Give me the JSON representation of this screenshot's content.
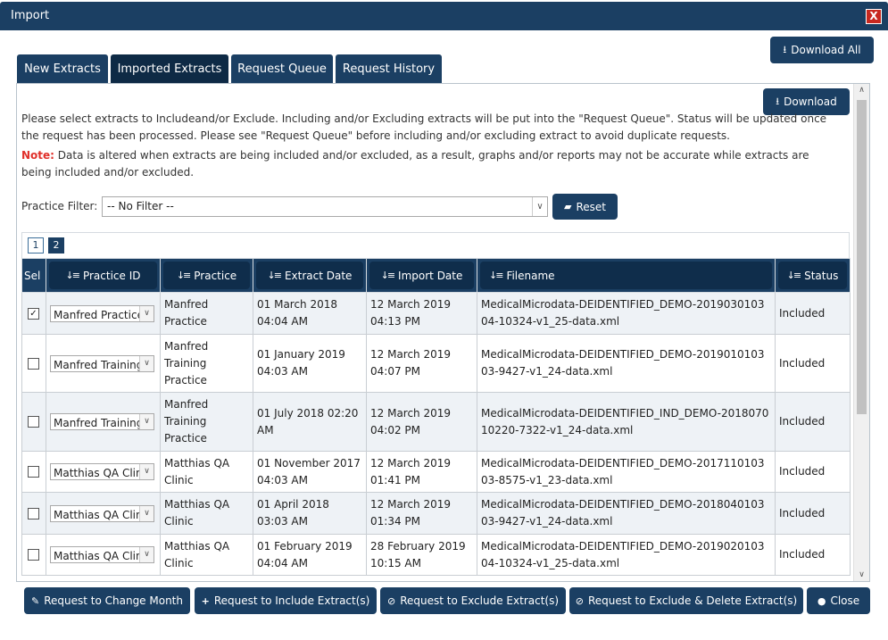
{
  "window": {
    "title": "Import",
    "close_glyph": "X"
  },
  "toolbar": {
    "download_all": "Download All",
    "download": "Download",
    "reset": "Reset"
  },
  "tabs": [
    {
      "label": "New Extracts",
      "active": false
    },
    {
      "label": "Imported Extracts",
      "active": true
    },
    {
      "label": "Request Queue",
      "active": false
    },
    {
      "label": "Request History",
      "active": false
    }
  ],
  "intro": "Please select extracts to Includeand/or Exclude. Including and/or Excluding extracts will be put into the \"Request Queue\". Status will be updated once the request has been processed. Please see \"Request Queue\" before including and/or excluding extract to avoid duplicate requests.",
  "note": {
    "label": "Note:",
    "text": " Data is altered when extracts are being included and/or excluded, as a result, graphs and/or reports may not be accurate while extracts are being included and/or excluded."
  },
  "filter": {
    "label": "Practice Filter:",
    "value": "-- No Filter --"
  },
  "pagination": {
    "pages": [
      "1",
      "2"
    ],
    "current": "2"
  },
  "table": {
    "columns": [
      "Sel",
      "Practice ID",
      "Practice",
      "Extract Date",
      "Import Date",
      "Filename",
      "Status"
    ],
    "rows": [
      {
        "checked": true,
        "practice_id": "Manfred Practice",
        "practice": "Manfred Practice",
        "extract_date": "01 March 2018 04:04 AM",
        "import_date": "12 March 2019 04:13 PM",
        "filename": "MedicalMicrodata-DEIDENTIFIED_DEMO-201903010304-10324-v1_25-data.xml",
        "status": "Included"
      },
      {
        "checked": false,
        "practice_id": "Manfred Training Practice",
        "practice": "Manfred Training Practice",
        "extract_date": "01 January 2019 04:03 AM",
        "import_date": "12 March 2019 04:07 PM",
        "filename": "MedicalMicrodata-DEIDENTIFIED_DEMO-201901010303-9427-v1_24-data.xml",
        "status": "Included"
      },
      {
        "checked": false,
        "practice_id": "Manfred Training Practice",
        "practice": "Manfred Training Practice",
        "extract_date": "01 July 2018 02:20 AM",
        "import_date": "12 March 2019 04:02 PM",
        "filename": "MedicalMicrodata-DEIDENTIFIED_IND_DEMO-201807010220-7322-v1_24-data.xml",
        "status": "Included"
      },
      {
        "checked": false,
        "practice_id": "Matthias QA Clinic",
        "practice": "Matthias QA Clinic",
        "extract_date": "01 November 2017 04:03 AM",
        "import_date": "12 March 2019 01:41 PM",
        "filename": "MedicalMicrodata-DEIDENTIFIED_DEMO-201711010303-8575-v1_23-data.xml",
        "status": "Included"
      },
      {
        "checked": false,
        "practice_id": "Matthias QA Clinic",
        "practice": "Matthias QA Clinic",
        "extract_date": "01 April 2018 03:03 AM",
        "import_date": "12 March 2019 01:34 PM",
        "filename": "MedicalMicrodata-DEIDENTIFIED_DEMO-201804010303-9427-v1_24-data.xml",
        "status": "Included"
      },
      {
        "checked": false,
        "practice_id": "Matthias QA Clinic",
        "practice": "Matthias QA Clinic",
        "extract_date": "01 February 2019 04:04 AM",
        "import_date": "28 February 2019 10:15 AM",
        "filename": "MedicalMicrodata-DEIDENTIFIED_DEMO-201902010304-10324-v1_25-data.xml",
        "status": "Included"
      }
    ]
  },
  "footer": {
    "change_month": "Request to Change Month",
    "include": "Request to Include Extract(s)",
    "exclude": "Request to Exclude Extract(s)",
    "exclude_delete": "Request to Exclude & Delete Extract(s)",
    "close": "Close"
  },
  "colors": {
    "primary": "#1b3f63",
    "header_dark": "#0f2d4b",
    "status_green": "#2f8f2f",
    "note_red": "#e0302a",
    "close_red": "#c8281f"
  },
  "icons": [
    "download-icon",
    "eraser-icon",
    "sort-icon",
    "edit-icon",
    "plus-icon",
    "ban-icon",
    "circle-icon",
    "close-icon",
    "chevron-down-icon",
    "chevron-up-icon"
  ]
}
